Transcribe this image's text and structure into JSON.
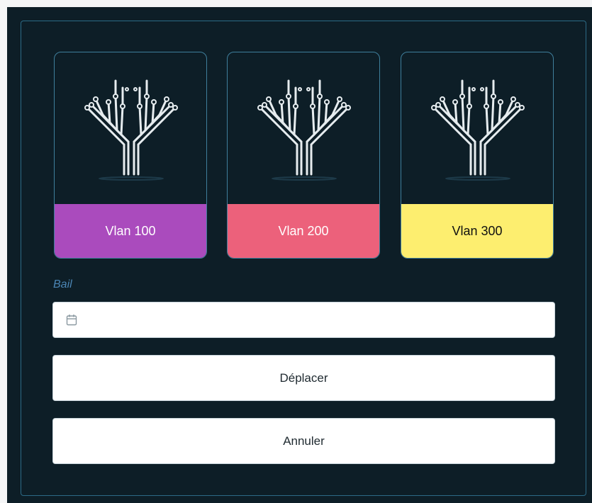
{
  "vlans": [
    {
      "label": "Vlan 100",
      "color": "#aa4bbd",
      "icon": "circuit-tree-icon"
    },
    {
      "label": "Vlan 200",
      "color": "#ec617b",
      "icon": "circuit-tree-icon"
    },
    {
      "label": "Vlan 300",
      "color": "#fdee6f",
      "icon": "circuit-tree-icon"
    }
  ],
  "bail": {
    "label": "Bail",
    "value": "",
    "icon": "calendar-icon"
  },
  "actions": {
    "move_label": "Déplacer",
    "cancel_label": "Annuler"
  },
  "colors": {
    "background": "#0d1e27",
    "border": "#2c6a86",
    "label": "#4b86b5"
  }
}
